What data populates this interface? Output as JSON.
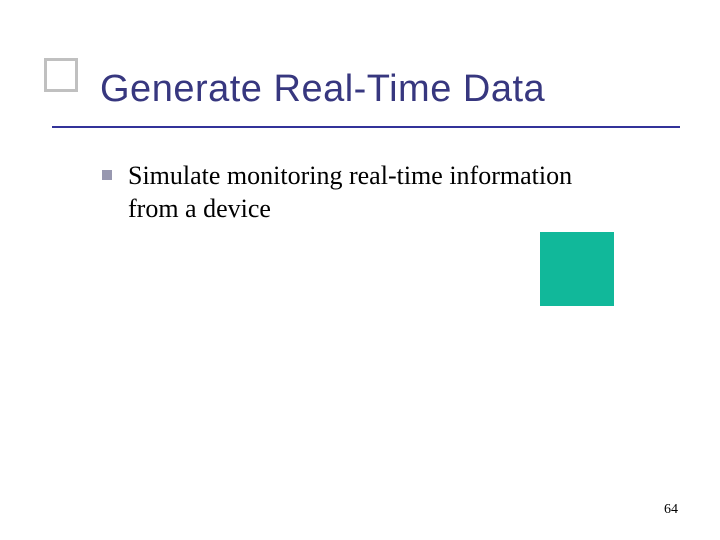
{
  "slide": {
    "title": "Generate Real-Time Data",
    "bullets": [
      "Simulate monitoring real-time information from a device"
    ],
    "page_number": "64"
  }
}
